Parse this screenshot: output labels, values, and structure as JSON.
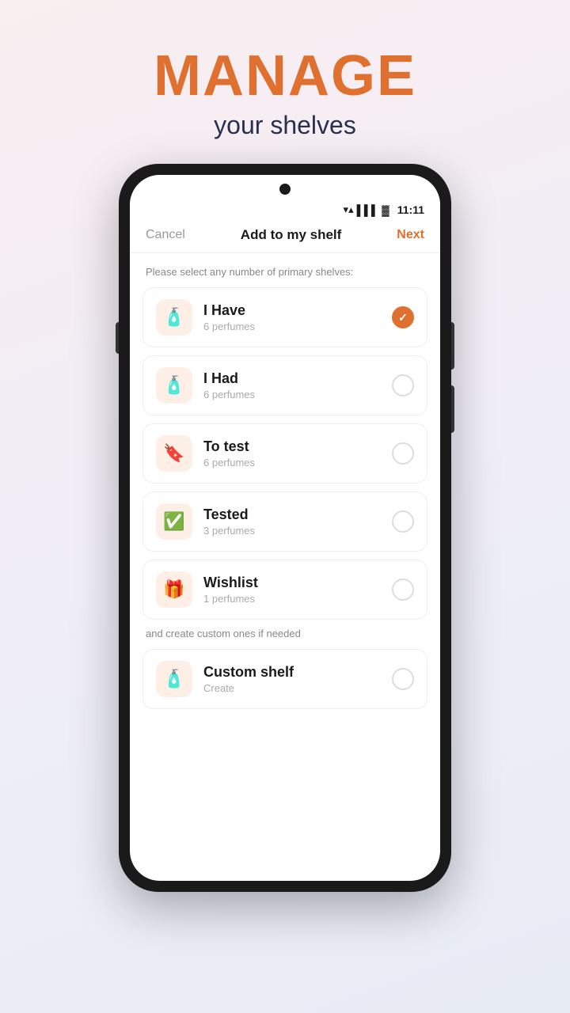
{
  "header": {
    "title_main": "MANAGE",
    "title_sub": "your shelves"
  },
  "status_bar": {
    "time": "11:11",
    "wifi_icon": "wifi",
    "signal_icon": "signal",
    "battery_icon": "battery"
  },
  "app_navbar": {
    "cancel_label": "Cancel",
    "title": "Add to my shelf",
    "next_label": "Next"
  },
  "section_primary_label": "Please select any number of primary shelves:",
  "shelves": [
    {
      "id": "i-have",
      "name": "I Have",
      "count": "6 perfumes",
      "icon": "🧴",
      "checked": true
    },
    {
      "id": "i-had",
      "name": "I Had",
      "count": "6 perfumes",
      "icon": "🧴",
      "checked": false
    },
    {
      "id": "to-test",
      "name": "To test",
      "count": "6 perfumes",
      "icon": "🔖",
      "checked": false
    },
    {
      "id": "tested",
      "name": "Tested",
      "count": "3 perfumes",
      "icon": "✅",
      "checked": false
    },
    {
      "id": "wishlist",
      "name": "Wishlist",
      "count": "1 perfumes",
      "icon": "🎁",
      "checked": false
    }
  ],
  "section_custom_label": "and create custom ones if needed",
  "custom_shelf": {
    "name": "Custom shelf",
    "subtitle": "Create",
    "icon": "🧴",
    "checked": false
  }
}
